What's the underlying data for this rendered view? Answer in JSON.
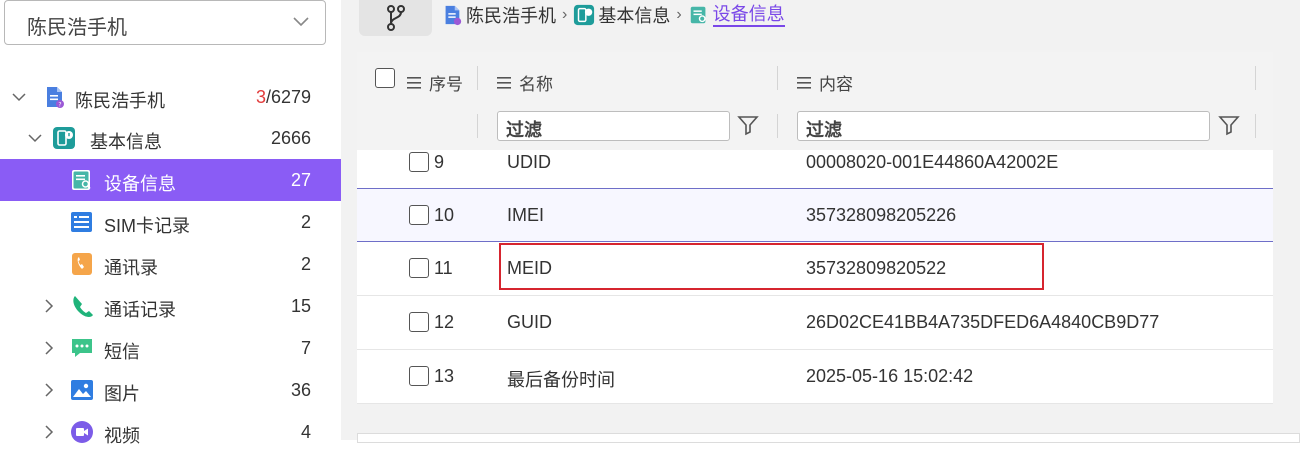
{
  "device_selector": {
    "value": "陈民浩手机"
  },
  "tree": {
    "root": {
      "label": "陈民浩手机",
      "count_highlight": "3",
      "count_rest": "/6279"
    },
    "basic_info": {
      "label": "基本信息",
      "count": "2666"
    },
    "items": [
      {
        "label": "设备信息",
        "count": "27",
        "icon": "device-info-icon",
        "selected": true
      },
      {
        "label": "SIM卡记录",
        "count": "2",
        "icon": "sim-record-icon"
      },
      {
        "label": "通讯录",
        "count": "2",
        "icon": "contacts-icon"
      },
      {
        "label": "通话记录",
        "count": "15",
        "icon": "phone-icon",
        "expandable": true
      },
      {
        "label": "短信",
        "count": "7",
        "icon": "sms-icon",
        "expandable": true
      },
      {
        "label": "图片",
        "count": "36",
        "icon": "image-icon",
        "expandable": true
      },
      {
        "label": "视频",
        "count": "4",
        "icon": "video-icon",
        "expandable": true
      }
    ]
  },
  "breadcrumb": [
    "陈民浩手机",
    "基本信息",
    "设备信息"
  ],
  "table": {
    "columns": {
      "index": "序号",
      "name": "名称",
      "content": "内容"
    },
    "filter_placeholder": "过滤",
    "rows": [
      {
        "num": "9",
        "name": "UDID",
        "content": "00008020-001E44860A42002E"
      },
      {
        "num": "10",
        "name": "IMEI",
        "content": "357328098205226",
        "highlighted": true
      },
      {
        "num": "11",
        "name": "MEID",
        "content": "35732809820522"
      },
      {
        "num": "12",
        "name": "GUID",
        "content": "26D02CE41BB4A735DFED6A4840CB9D77"
      },
      {
        "num": "13",
        "name": "最后备份时间",
        "content": "2025-05-16 15:02:42"
      }
    ]
  },
  "colors": {
    "accent": "#8a5cf5",
    "highlight_box": "#d6252f",
    "teal": "#1e9c9a"
  }
}
